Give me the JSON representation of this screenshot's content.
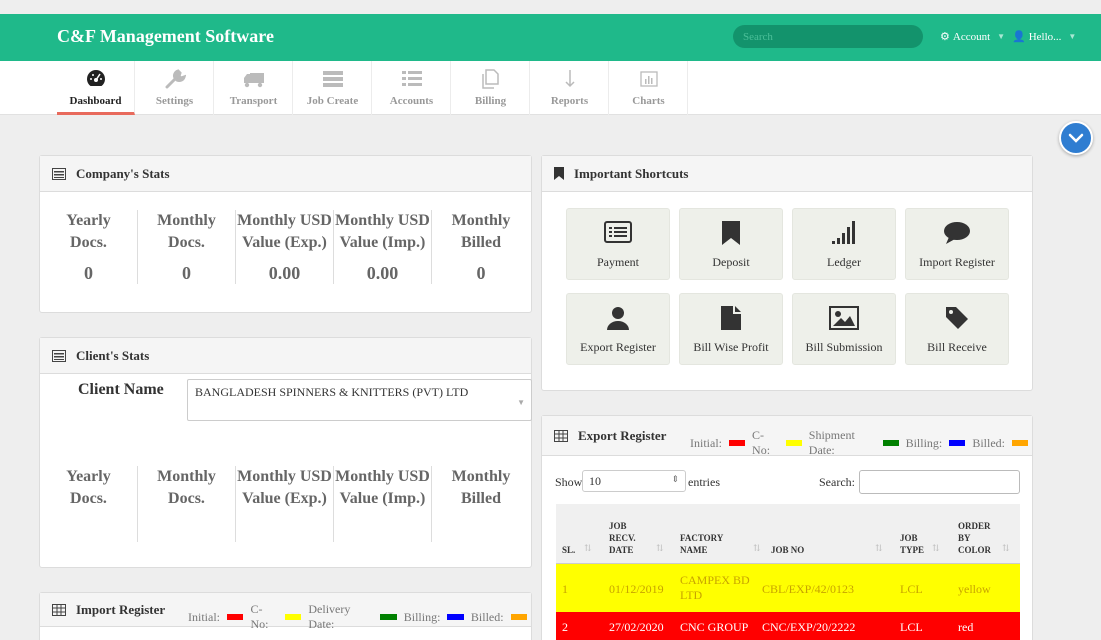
{
  "header": {
    "brand": "C&F Management Software",
    "search_placeholder": "Search",
    "account_label": "Account",
    "hello_label": "Hello...",
    "color": "#1fb98a"
  },
  "nav": [
    {
      "label": "Dashboard",
      "icon": "dashboard-icon",
      "active": true
    },
    {
      "label": "Settings",
      "icon": "wrench-icon"
    },
    {
      "label": "Transport",
      "icon": "truck-icon"
    },
    {
      "label": "Job Create",
      "icon": "server-icon"
    },
    {
      "label": "Accounts",
      "icon": "list-icon"
    },
    {
      "label": "Billing",
      "icon": "copy-icon"
    },
    {
      "label": "Reports",
      "icon": "arrow-down-icon"
    },
    {
      "label": "Charts",
      "icon": "chart-icon"
    }
  ],
  "company_stats": {
    "title": "Company's Stats",
    "items": [
      {
        "l1": "Yearly",
        "l2": "Docs.",
        "value": "0"
      },
      {
        "l1": "Monthly",
        "l2": "Docs.",
        "value": "0"
      },
      {
        "l1": "Monthly USD",
        "l2": "Value (Exp.)",
        "value": "0.00"
      },
      {
        "l1": "Monthly USD",
        "l2": "Value (Imp.)",
        "value": "0.00"
      },
      {
        "l1": "Monthly",
        "l2": "Billed",
        "value": "0"
      }
    ]
  },
  "client_stats": {
    "title": "Client's Stats",
    "client_label": "Client Name",
    "client_value": "BANGLADESH SPINNERS & KNITTERS (PVT) LTD",
    "items": [
      {
        "l1": "Yearly",
        "l2": "Docs."
      },
      {
        "l1": "Monthly",
        "l2": "Docs."
      },
      {
        "l1": "Monthly USD",
        "l2": "Value (Exp.)"
      },
      {
        "l1": "Monthly USD",
        "l2": "Value (Imp.)"
      },
      {
        "l1": "Monthly",
        "l2": "Billed"
      }
    ]
  },
  "import_register": {
    "title": "Import Register",
    "legend": [
      "Initial:",
      "C-No:",
      "Delivery Date:",
      "Billing:",
      "Billed:"
    ]
  },
  "shortcuts": {
    "title": "Important Shortcuts",
    "items": [
      {
        "label": "Payment",
        "icon": "list-alt-icon"
      },
      {
        "label": "Deposit",
        "icon": "bookmark-icon"
      },
      {
        "label": "Ledger",
        "icon": "signal-icon"
      },
      {
        "label": "Import Register",
        "icon": "comment-icon"
      },
      {
        "label": "Export Register",
        "icon": "user-icon"
      },
      {
        "label": "Bill Wise Profit",
        "icon": "file-icon"
      },
      {
        "label": "Bill Submission",
        "icon": "picture-icon"
      },
      {
        "label": "Bill Receive",
        "icon": "tag-icon"
      }
    ]
  },
  "export_register": {
    "title": "Export Register",
    "legend": [
      "Initial:",
      "C-No:",
      "Shipment Date:",
      "Billing:",
      "Billed:"
    ],
    "legend_colors": [
      "#ff0000",
      "#ffff00",
      "#008000",
      "#0000ff",
      "#ffa500"
    ],
    "show_label": "Show",
    "entries_value": "10",
    "entries_label": "entries",
    "search_label": "Search:",
    "columns": [
      {
        "l1": "",
        "l2": "",
        "l3": "SL."
      },
      {
        "l1": "JOB",
        "l2": "RECV.",
        "l3": "DATE"
      },
      {
        "l1": "",
        "l2": "FACTORY",
        "l3": "NAME"
      },
      {
        "l1": "",
        "l2": "",
        "l3": "JOB NO"
      },
      {
        "l1": "",
        "l2": "JOB",
        "l3": "TYPE"
      },
      {
        "l1": "ORDER",
        "l2": "BY",
        "l3": "COLOR"
      }
    ],
    "rows": [
      {
        "sl": "1",
        "date": "01/12/2019",
        "factory1": "CAMPEX BD",
        "factory2": "LTD",
        "job_no": "CBL/EXP/42/0123",
        "type": "LCL",
        "color": "yellow",
        "bg": "#ffff00"
      },
      {
        "sl": "2",
        "date": "27/02/2020",
        "factory1": "CNC GROUP",
        "factory2": "",
        "job_no": "CNC/EXP/20/2222",
        "type": "LCL",
        "color": "red",
        "bg": "#ff0000"
      }
    ]
  }
}
